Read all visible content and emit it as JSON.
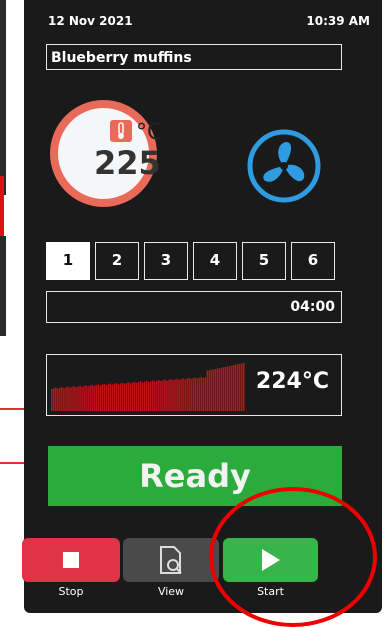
{
  "header": {
    "date": "12 Nov 2021",
    "time": "10:39 AM"
  },
  "recipe": {
    "name": "Blueberry muffins"
  },
  "gauge": {
    "set_temp": "225",
    "unit": "°C"
  },
  "steps": [
    "1",
    "2",
    "3",
    "4",
    "5",
    "6"
  ],
  "active_step": "1",
  "timer": {
    "value": "04:00"
  },
  "graph": {
    "current_temp": "224°C"
  },
  "status": {
    "label": "Ready"
  },
  "controls": {
    "stop": "Stop",
    "view": "View",
    "start": "Start"
  },
  "colors": {
    "accent_green": "#2bab3b",
    "stop_red": "#e03446",
    "gauge_red": "#e96a58",
    "fan_blue": "#2f9be0",
    "graph_red": "#c0121a"
  },
  "icons": [
    "thermometer-icon",
    "fan-icon",
    "stop-icon",
    "recipe-view-icon",
    "play-icon"
  ]
}
